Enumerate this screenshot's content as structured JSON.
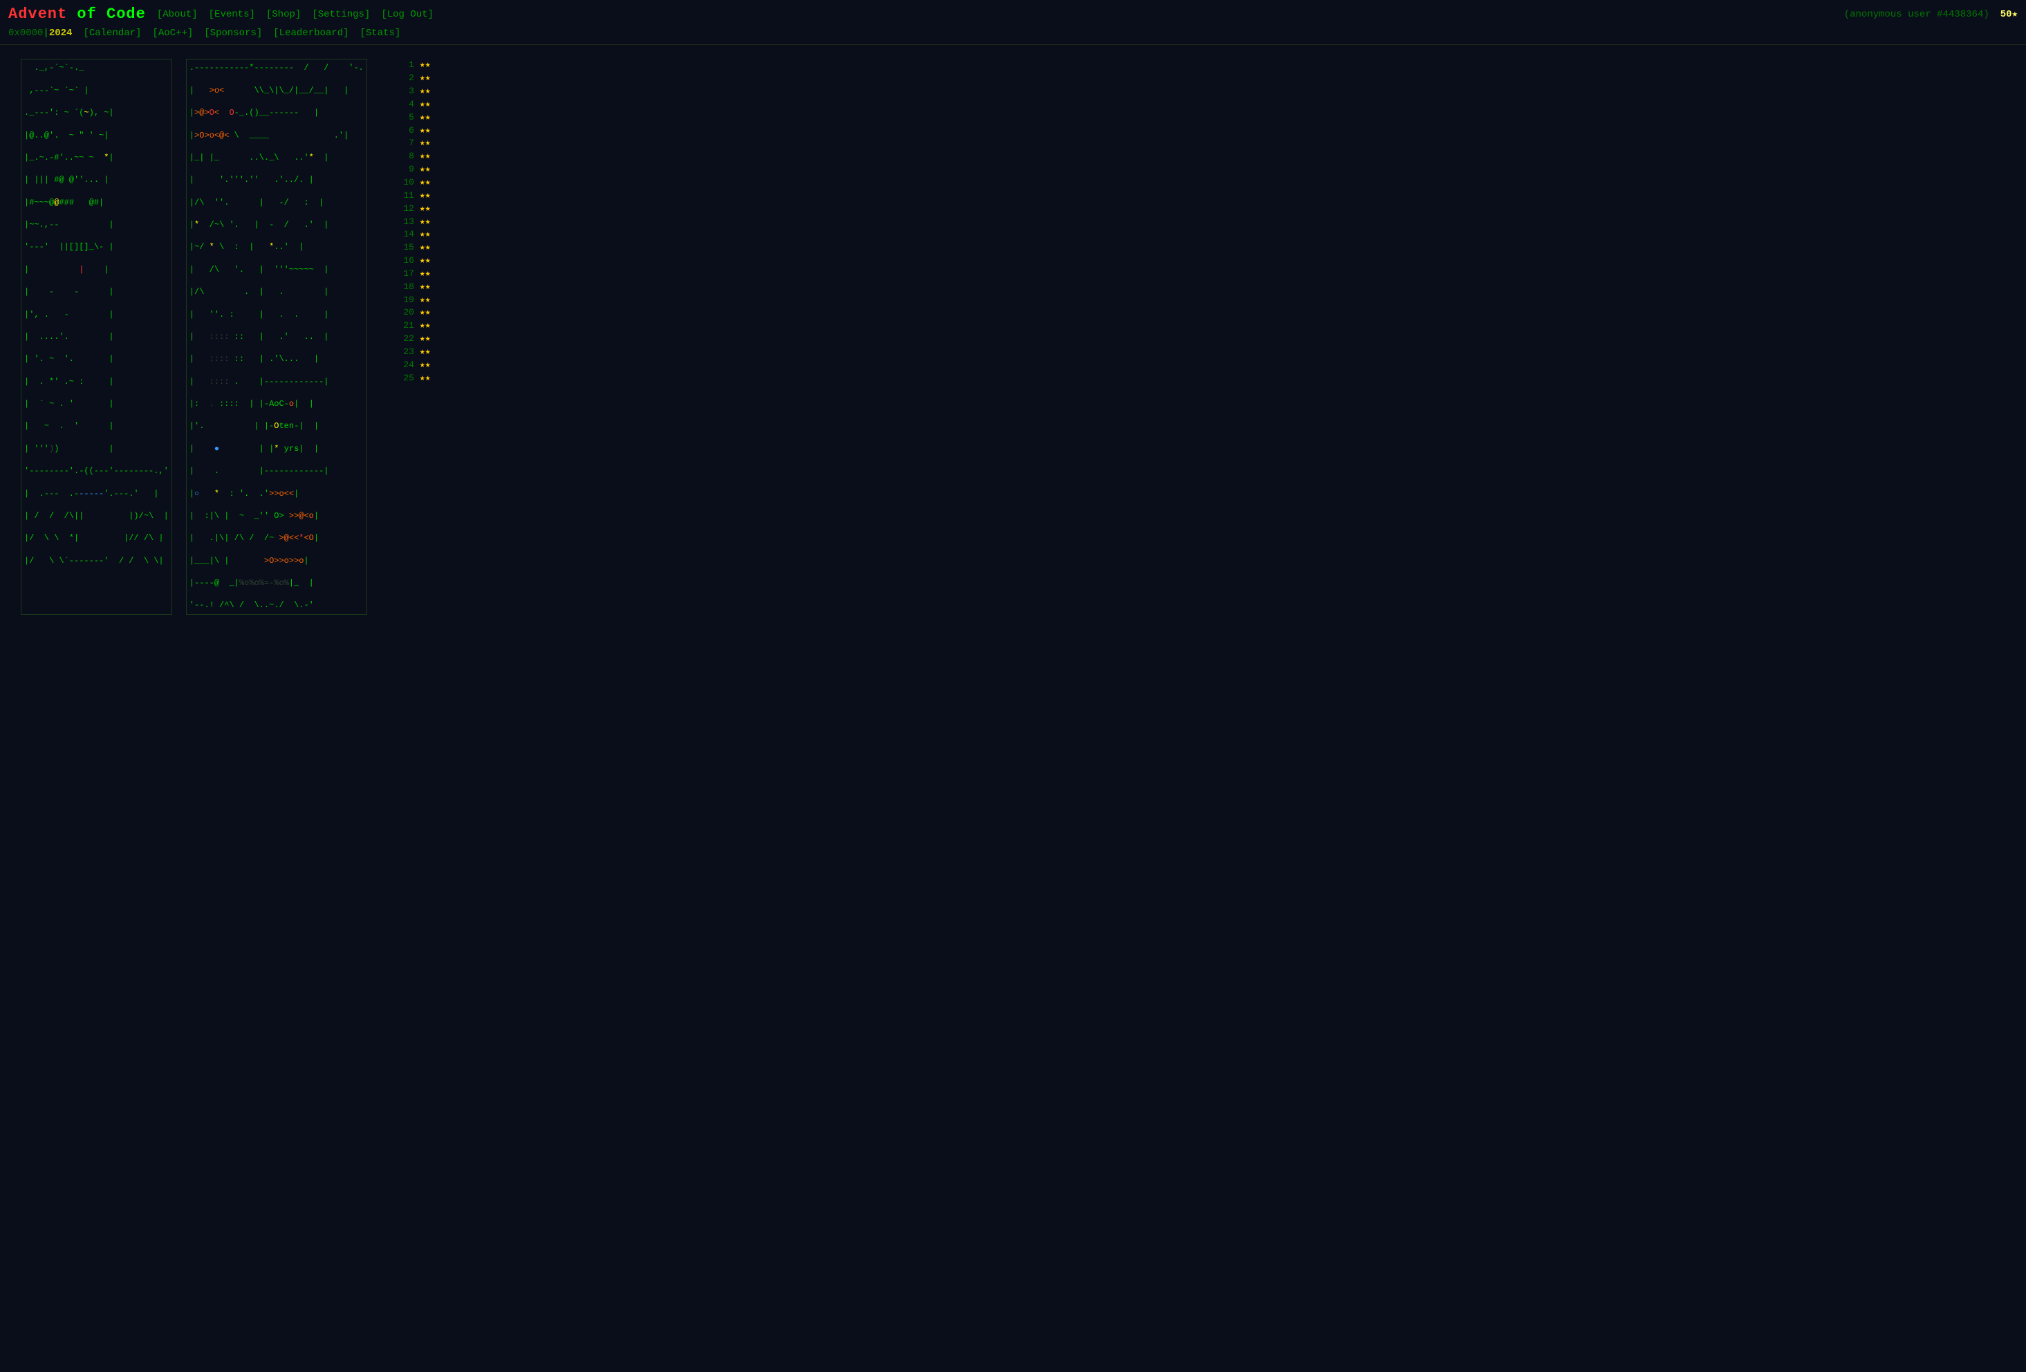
{
  "header": {
    "title": "Advent of Code",
    "hex": "0x0000",
    "year": "2024",
    "nav_row1": [
      {
        "label": "[About]",
        "href": "#about"
      },
      {
        "label": "[Events]",
        "href": "#events"
      },
      {
        "label": "[Shop]",
        "href": "#shop"
      },
      {
        "label": "[Settings]",
        "href": "#settings"
      },
      {
        "label": "[Log Out]",
        "href": "#logout"
      }
    ],
    "nav_row2": [
      {
        "label": "[Calendar]",
        "href": "#calendar"
      },
      {
        "label": "[AoC++]",
        "href": "#aocpp"
      },
      {
        "label": "[Sponsors]",
        "href": "#sponsors"
      },
      {
        "label": "[Leaderboard]",
        "href": "#leaderboard"
      },
      {
        "label": "[Stats]",
        "href": "#stats"
      }
    ],
    "user_info": "(anonymous user #4438364)",
    "stars": "50★"
  },
  "days": [
    {
      "num": "1",
      "stars": "★★"
    },
    {
      "num": "2",
      "stars": "★★"
    },
    {
      "num": "3",
      "stars": "★★"
    },
    {
      "num": "4",
      "stars": "★★"
    },
    {
      "num": "5",
      "stars": "★★"
    },
    {
      "num": "6",
      "stars": "★★"
    },
    {
      "num": "7",
      "stars": "★★"
    },
    {
      "num": "8",
      "stars": "★★"
    },
    {
      "num": "9",
      "stars": "★★"
    },
    {
      "num": "10",
      "stars": "★★"
    },
    {
      "num": "11",
      "stars": "★★"
    },
    {
      "num": "12",
      "stars": "★★"
    },
    {
      "num": "13",
      "stars": "★★"
    },
    {
      "num": "14",
      "stars": "★★"
    },
    {
      "num": "15",
      "stars": "★★"
    },
    {
      "num": "16",
      "stars": "★★"
    },
    {
      "num": "17",
      "stars": "★★"
    },
    {
      "num": "18",
      "stars": "★★"
    },
    {
      "num": "19",
      "stars": "★★"
    },
    {
      "num": "20",
      "stars": "★★"
    },
    {
      "num": "21",
      "stars": "★★"
    },
    {
      "num": "22",
      "stars": "★★"
    },
    {
      "num": "23",
      "stars": "★★"
    },
    {
      "num": "24",
      "stars": "★★"
    },
    {
      "num": "25",
      "stars": "★★"
    }
  ]
}
